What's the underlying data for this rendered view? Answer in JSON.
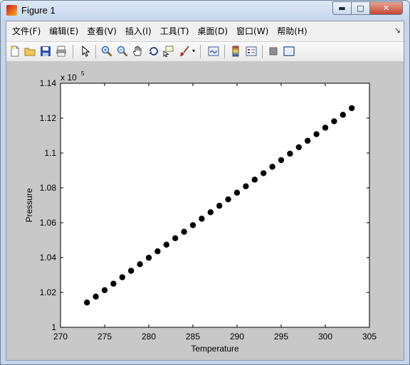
{
  "window": {
    "title": "Figure 1",
    "min_symbol": "▬",
    "max_symbol": "□",
    "close_symbol": "✕"
  },
  "menu": {
    "items": [
      "文件(F)",
      "编辑(E)",
      "查看(V)",
      "插入(I)",
      "工具(T)",
      "桌面(D)",
      "窗口(W)",
      "帮助(H)"
    ],
    "end_glyph": "↘"
  },
  "toolbar": {
    "icons": [
      "new-figure-icon",
      "open-folder-icon",
      "save-icon",
      "print-icon",
      "pointer-icon",
      "zoom-in-icon",
      "zoom-out-icon",
      "pan-hand-icon",
      "rotate-3d-icon",
      "data-cursor-icon",
      "brush-icon",
      "brush-dropdown-icon",
      "link-plot-icon",
      "colorbar-icon",
      "legend-icon",
      "hide-plot-tools-icon",
      "show-plot-tools-icon"
    ]
  },
  "chart_data": {
    "type": "scatter",
    "title": "",
    "xlabel": "Temperature",
    "ylabel": "Pressure",
    "xlim": [
      270,
      305
    ],
    "ylim": [
      100000,
      114000
    ],
    "x_ticks": [
      "270",
      "275",
      "280",
      "285",
      "290",
      "295",
      "300",
      "305"
    ],
    "y_ticks": [
      "1",
      "1.02",
      "1.04",
      "1.06",
      "1.08",
      "1.1",
      "1.12",
      "1.14"
    ],
    "y_multiplier_base": "x 10",
    "y_multiplier_exp": "5",
    "grid": false,
    "marker_color": "#000000",
    "series": [
      {
        "x": [
          273,
          274,
          275,
          276,
          277,
          278,
          279,
          280,
          281,
          282,
          283,
          284,
          285,
          286,
          287,
          288,
          289,
          290,
          291,
          292,
          293,
          294,
          295,
          296,
          297,
          298,
          299,
          300,
          301,
          302,
          303
        ],
        "y": [
          101420,
          101760,
          102130,
          102500,
          102870,
          103240,
          103620,
          103990,
          104360,
          104740,
          105110,
          105480,
          105860,
          106230,
          106600,
          106970,
          107340,
          107720,
          108090,
          108470,
          108840,
          109210,
          109590,
          109960,
          110330,
          110700,
          111080,
          111450,
          111820,
          112190,
          112570
        ]
      }
    ]
  }
}
